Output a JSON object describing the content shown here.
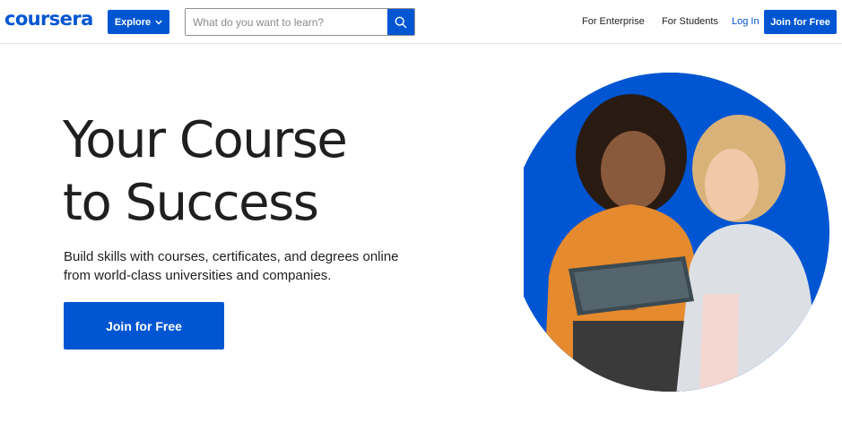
{
  "header": {
    "logo": "coursera",
    "explore_label": "Explore",
    "search_placeholder": "What do you want to learn?",
    "nav": {
      "enterprise": "For Enterprise",
      "students": "For Students",
      "login": "Log In",
      "join": "Join for Free"
    }
  },
  "hero": {
    "title_line1": "Your Course",
    "title_line2": "to Success",
    "subtitle_line1": "Build skills with courses, certificates, and degrees online",
    "subtitle_line2": "from world-class universities and companies.",
    "cta": "Join for Free"
  },
  "colors": {
    "brand": "#0056d2",
    "text": "#1f1f1f"
  },
  "icons": [
    "chevron-down-icon",
    "search-icon"
  ]
}
